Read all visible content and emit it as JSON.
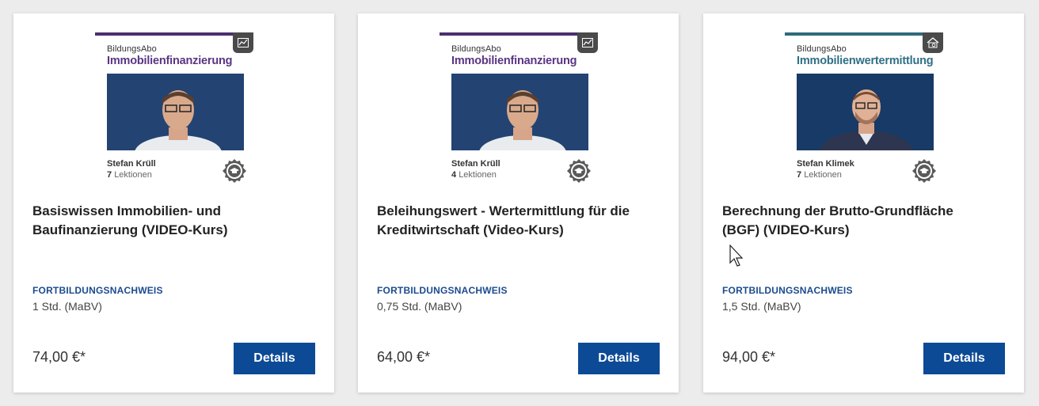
{
  "cards": [
    {
      "topbar_color": "#4a2f6e",
      "brand_color": "#5a3582",
      "thumb": {
        "eyebrow": "BildungsAbo",
        "brand": "Immobilienfinanzierung",
        "speaker": "Stefan Krüll",
        "lessons_count": "7",
        "lessons_label": "Lektionen",
        "badge_icon": "chart-icon"
      },
      "title": "Basiswissen Immobilien- und Baufinanzierung (VIDEO-Kurs)",
      "cert_label": "FORTBILDUNGSNACHWEIS",
      "cert_value": "1 Std. (MaBV)",
      "price": "74,00 €*",
      "button_label": "Details"
    },
    {
      "topbar_color": "#4a2f6e",
      "brand_color": "#5a3582",
      "thumb": {
        "eyebrow": "BildungsAbo",
        "brand": "Immobilienfinanzierung",
        "speaker": "Stefan Krüll",
        "lessons_count": "4",
        "lessons_label": "Lektionen",
        "badge_icon": "chart-icon"
      },
      "title": "Beleihungswert - Wertermittlung für die Kreditwirtschaft (Video-Kurs)",
      "cert_label": "FORTBILDUNGSNACHWEIS",
      "cert_value": "0,75 Std. (MaBV)",
      "price": "64,00 €*",
      "button_label": "Details"
    },
    {
      "topbar_color": "#2f6a7a",
      "brand_color": "#2f6f86",
      "thumb": {
        "eyebrow": "BildungsAbo",
        "brand": "Immobilienwertermittlung",
        "speaker": "Stefan Klimek",
        "lessons_count": "7",
        "lessons_label": "Lektionen",
        "badge_icon": "house-search-icon"
      },
      "title": "Berechnung der Brutto-Grundfläche (BGF) (VIDEO-Kurs)",
      "cert_label": "FORTBILDUNGSNACHWEIS",
      "cert_value": "1,5 Std. (MaBV)",
      "price": "94,00 €*",
      "button_label": "Details"
    }
  ],
  "colors": {
    "accent_blue": "#0c4a96",
    "label_blue": "#1c4b8e",
    "video_bg": "#1f3d6b"
  }
}
